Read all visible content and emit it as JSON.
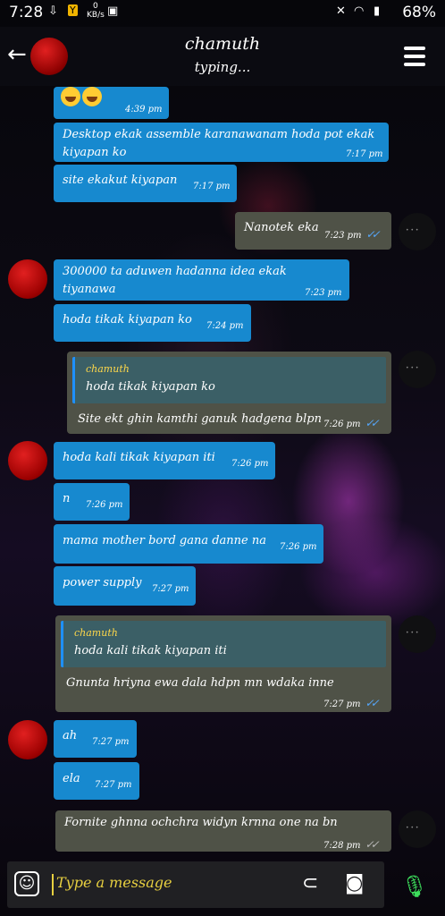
{
  "status_bar": {
    "time": "7:28",
    "net_speed": "0",
    "net_unit": "KB/s",
    "battery": "68%"
  },
  "header": {
    "contact_name": "chamuth",
    "contact_status": "typing..."
  },
  "messages": [
    {
      "dir": "in",
      "text": "",
      "time": "4:39 pm",
      "emoji_count": 2
    },
    {
      "dir": "in",
      "text": "Desktop ekak assemble karanawanam hoda pot ekak kiyapan ko",
      "time": "7:17 pm"
    },
    {
      "dir": "in",
      "text": "site ekakut kiyapan",
      "time": "7:17 pm"
    },
    {
      "dir": "out",
      "text": "Nanotek eka",
      "time": "7:23 pm",
      "tick": "✓✓"
    },
    {
      "dir": "in",
      "text": "300000 ta aduwen hadanna idea ekak tiyanawa",
      "time": "7:23 pm"
    },
    {
      "dir": "in",
      "text": "hoda tikak kiyapan ko",
      "time": "7:24 pm"
    },
    {
      "dir": "out",
      "quote_name": "chamuth",
      "quote_text": "hoda tikak kiyapan ko",
      "text": "Site ekt ghin kamthi ganuk hadgena blpn",
      "time": "7:26 pm",
      "tick": "✓✓"
    },
    {
      "dir": "in",
      "text": "hoda kali tikak kiyapan iti",
      "time": "7:26 pm"
    },
    {
      "dir": "in",
      "text": "n",
      "time": "7:26 pm"
    },
    {
      "dir": "in",
      "text": "mama mother bord gana danne na",
      "time": "7:26 pm"
    },
    {
      "dir": "in",
      "text": "power supply",
      "time": "7:27 pm"
    },
    {
      "dir": "out",
      "quote_name": "chamuth",
      "quote_text": "hoda kali tikak kiyapan iti",
      "text": "Gnunta hriyna ewa dala hdpn mn wdaka inne",
      "time": "7:27 pm",
      "tick": "✓✓"
    },
    {
      "dir": "in",
      "text": "ah",
      "time": "7:27 pm"
    },
    {
      "dir": "in",
      "text": "ela",
      "time": "7:27 pm"
    },
    {
      "dir": "out",
      "text": "Fornite ghnna ochchra widyn krnna one na bn",
      "time": "7:28 pm",
      "tick": "✓✓",
      "tick_color": "#bbbbbb"
    }
  ],
  "input": {
    "placeholder": "Type a message"
  },
  "colors": {
    "incoming": "#1789cf",
    "outgoing": "#4f5247",
    "read_tick": "#56a9ff",
    "placeholder": "#e8d040",
    "mic": "#3ddf5c"
  },
  "icons": [
    "back-arrow-icon",
    "menu-icon",
    "emoji-icon",
    "attach-icon",
    "camera-icon",
    "mic-icon"
  ]
}
